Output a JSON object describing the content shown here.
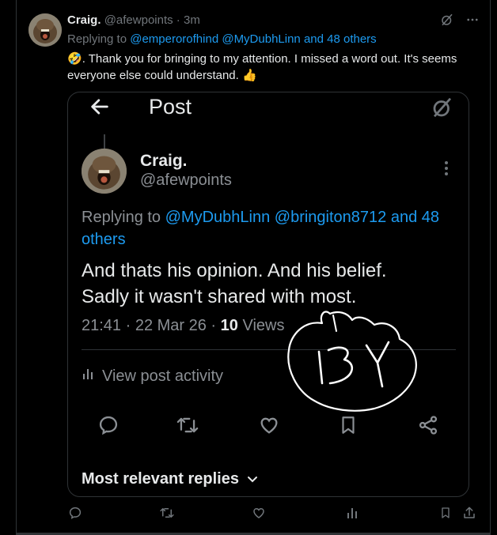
{
  "tweet": {
    "author_name": "Craig.",
    "author_handle": "@afewpoints",
    "time_sep": " · ",
    "time": "3m",
    "replying_prefix": "Replying to ",
    "replying_links": "@emperorofhind @MyDubhLinn and 48 others",
    "emoji": "🤣",
    "text": ". Thank you for bringing to my attention. I missed a word out. It's seems everyone else could understand. ",
    "thumb": "👍"
  },
  "embedded": {
    "header_title": "Post",
    "author_name": "Craig.",
    "author_handle": "@afewpoints",
    "replying_prefix": "Replying to ",
    "replying_links": "@MyDubhLinn @bringiton8712 and 48 others",
    "text_line1": "And thats his opinion. And his belief.",
    "text_line2": "Sadly it wasn't shared with most.",
    "timestamp": "21:41 · 22 Mar 26 · ",
    "views_count": "10",
    "views_label": " Views",
    "activity_label": "View post activity",
    "relevant_label": "Most relevant replies",
    "scribble_text": "13Y"
  },
  "icons": {
    "back": "arrow-left-icon",
    "grok": "grok-icon",
    "more": "more-dots-icon",
    "reply": "reply-icon",
    "retweet": "retweet-icon",
    "like": "heart-icon",
    "bookmark": "bookmark-icon",
    "share": "share-icon",
    "views": "bar-chart-icon",
    "chevron": "chevron-down-icon"
  },
  "colors": {
    "background": "#000000",
    "text": "#e7e9ea",
    "muted": "#71767b",
    "link": "#1d9bf0",
    "border": "#2f3336"
  }
}
